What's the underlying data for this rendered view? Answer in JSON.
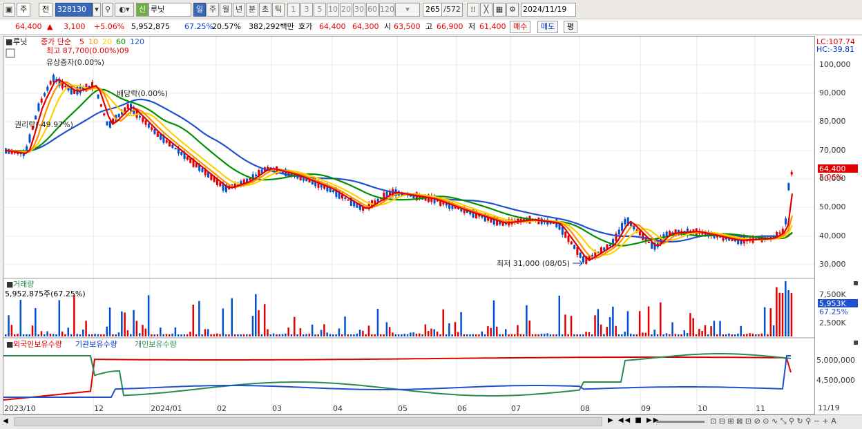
{
  "toolbar": {
    "period_main": "주",
    "period_prev": "전",
    "code": "328130",
    "name": "루닛",
    "tab_day": "일",
    "tab_week": "주",
    "tab_month": "월",
    "tab_year": "년",
    "tab_min": "분",
    "tab_sec": "초",
    "tab_tick": "틱",
    "intervals": [
      "1",
      "3",
      "5",
      "10",
      "20",
      "30",
      "60",
      "120"
    ],
    "count_current": "265",
    "count_total": "/572",
    "date": "2024/11/19",
    "chk_label": "신"
  },
  "info": {
    "price": "64,400",
    "change": "3,100",
    "change_pct": "+5.06%",
    "volume": "5,952,875",
    "turnover": "67.25%",
    "ratio": "20.57%",
    "amount": "382,292백만",
    "bid_label": "호가",
    "bid": "64,400",
    "ask": "64,300",
    "open_label": "시",
    "open": "63,500",
    "high_label": "고",
    "high": "66,900",
    "low_label": "저",
    "low": "61,400",
    "buy": "매수",
    "sell": "매도",
    "eval": "평"
  },
  "legend": {
    "name": "루닛",
    "ma_label": "종가 단순",
    "ma": [
      "5",
      "10",
      "20",
      "60",
      "120"
    ],
    "ma_colors": [
      "#e00000",
      "#ff9000",
      "#ffd000",
      "#009000",
      "#2050d0"
    ]
  },
  "annotations": {
    "rights": "권리락(-49.97%)",
    "rights_issue": "유상증자(0.00%)",
    "dividend": "배당락(0.00%)",
    "high_note": "최고 87,700(0.00%)09",
    "low_note": "최저 31,000 (08/05)"
  },
  "price_axis": {
    "lc": "LC:107.74",
    "hc": "HC:-39.81",
    "ticks": [
      "100,000",
      "90,000",
      "80,000",
      "70,000",
      "60,000",
      "50,000",
      "40,000",
      "30,000"
    ],
    "cur": "64,400",
    "cur_pct": "5.06%"
  },
  "volume": {
    "title": "거래량",
    "desc": "5,952,875주(67.25%)",
    "ticks": [
      "7,500K",
      "2,500K"
    ],
    "cur": "5,953K",
    "cur_pct": "67.25%"
  },
  "holdings": {
    "foreign": "외국인보유수량",
    "inst": "기관보유수량",
    "indiv": "개인보유수량",
    "ticks": [
      "5,000,000",
      "4,500,000"
    ]
  },
  "x_axis": [
    "2023/10",
    "12",
    "2024/01",
    "02",
    "03",
    "04",
    "05",
    "06",
    "07",
    "08",
    "09",
    "10",
    "11",
    "11/19"
  ],
  "colors": {
    "up": "#e00000",
    "down": "#0050d0",
    "ma5": "#e00000",
    "ma10": "#ff9000",
    "ma20": "#ffd000",
    "ma60": "#009000",
    "ma120": "#2050d0"
  }
}
